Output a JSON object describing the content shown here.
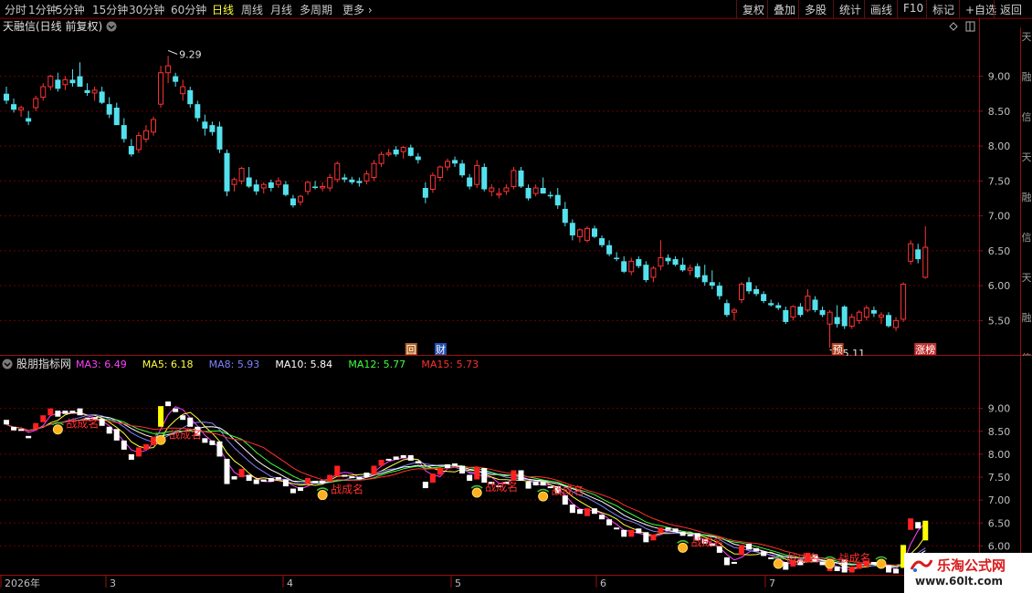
{
  "toolbar": {
    "periods": [
      "分时",
      "1分钟",
      "5分钟",
      "15分钟",
      "30分钟",
      "60分钟",
      "日线",
      "周线",
      "月线",
      "多周期",
      "更多"
    ],
    "active_period": "日线",
    "right_buttons": [
      "复权",
      "叠加",
      "多股",
      "统计",
      "画线",
      "F10",
      "标记",
      "+自选",
      "返回"
    ]
  },
  "main": {
    "title": "天融信(日线 前复权)",
    "side_label": "天融信",
    "high_label": "9.29",
    "low_label": "5.11",
    "badges": [
      "回",
      "财",
      "预",
      "涨榜"
    ]
  },
  "indicator": {
    "name": "股朋指标网",
    "ma": [
      {
        "label": "MA3:",
        "value": "6.49",
        "color": "#ff40ff"
      },
      {
        "label": "MA5:",
        "value": "6.18",
        "color": "#ffff40"
      },
      {
        "label": "MA8:",
        "value": "5.93",
        "color": "#8080ff"
      },
      {
        "label": "MA10:",
        "value": "5.84",
        "color": "#ffffff"
      },
      {
        "label": "MA12:",
        "value": "5.77",
        "color": "#40ff40"
      },
      {
        "label": "MA15:",
        "value": "5.73",
        "color": "#ff3030"
      }
    ],
    "signal_label": "战成名"
  },
  "axis": {
    "date_labels": [
      "2026年",
      "3",
      "4",
      "5",
      "6",
      "7"
    ]
  },
  "watermark": {
    "title": "乐淘公式网",
    "url": "www.60lt.com"
  },
  "colors": {
    "up": "#ff3333",
    "down": "#54e1ee",
    "grid": "#6b0000",
    "axis_text": "#c0c0c0"
  },
  "chart_data": {
    "type": "candlestick",
    "ylim": [
      5.1,
      9.7
    ],
    "yticks": [
      5.5,
      6.0,
      6.5,
      7.0,
      7.5,
      8.0,
      8.5,
      9.0
    ],
    "ohlc": [
      [
        8.75,
        8.85,
        8.6,
        8.65
      ],
      [
        8.6,
        8.68,
        8.48,
        8.52
      ],
      [
        8.52,
        8.58,
        8.42,
        8.55
      ],
      [
        8.4,
        8.5,
        8.3,
        8.35
      ],
      [
        8.55,
        8.72,
        8.5,
        8.68
      ],
      [
        8.7,
        8.9,
        8.65,
        8.85
      ],
      [
        8.85,
        9.02,
        8.8,
        9.0
      ],
      [
        8.95,
        9.05,
        8.78,
        8.82
      ],
      [
        8.88,
        9.0,
        8.8,
        8.95
      ],
      [
        8.95,
        9.1,
        8.85,
        8.9
      ],
      [
        9.0,
        9.2,
        8.95,
        8.85
      ],
      [
        8.8,
        8.9,
        8.72,
        8.76
      ],
      [
        8.76,
        8.85,
        8.65,
        8.8
      ],
      [
        8.78,
        8.85,
        8.6,
        8.62
      ],
      [
        8.6,
        8.7,
        8.4,
        8.45
      ],
      [
        8.55,
        8.62,
        8.4,
        8.3
      ],
      [
        8.3,
        8.4,
        8.05,
        8.1
      ],
      [
        8.0,
        8.1,
        7.85,
        7.88
      ],
      [
        7.95,
        8.2,
        7.9,
        8.15
      ],
      [
        8.1,
        8.3,
        8.05,
        8.22
      ],
      [
        8.2,
        8.42,
        8.15,
        8.38
      ],
      [
        8.6,
        9.15,
        8.55,
        9.05
      ],
      [
        9.05,
        9.29,
        8.9,
        9.15
      ],
      [
        9.0,
        9.05,
        8.85,
        8.92
      ],
      [
        8.75,
        8.95,
        8.65,
        8.85
      ],
      [
        8.8,
        8.85,
        8.55,
        8.6
      ],
      [
        8.6,
        8.65,
        8.35,
        8.4
      ],
      [
        8.35,
        8.45,
        8.15,
        8.25
      ],
      [
        8.3,
        8.35,
        8.15,
        8.2
      ],
      [
        8.28,
        8.35,
        7.9,
        7.95
      ],
      [
        7.9,
        7.95,
        7.28,
        7.35
      ],
      [
        7.45,
        7.55,
        7.35,
        7.52
      ],
      [
        7.5,
        7.7,
        7.45,
        7.68
      ],
      [
        7.55,
        7.7,
        7.4,
        7.42
      ],
      [
        7.45,
        7.52,
        7.3,
        7.35
      ],
      [
        7.4,
        7.48,
        7.32,
        7.45
      ],
      [
        7.48,
        7.52,
        7.35,
        7.4
      ],
      [
        7.45,
        7.55,
        7.4,
        7.5
      ],
      [
        7.45,
        7.5,
        7.28,
        7.3
      ],
      [
        7.25,
        7.3,
        7.12,
        7.15
      ],
      [
        7.2,
        7.3,
        7.15,
        7.28
      ],
      [
        7.35,
        7.5,
        7.3,
        7.48
      ],
      [
        7.42,
        7.5,
        7.38,
        7.4
      ],
      [
        7.4,
        7.48,
        7.35,
        7.42
      ],
      [
        7.4,
        7.6,
        7.35,
        7.55
      ],
      [
        7.52,
        7.78,
        7.48,
        7.75
      ],
      [
        7.55,
        7.6,
        7.48,
        7.52
      ],
      [
        7.52,
        7.56,
        7.45,
        7.48
      ],
      [
        7.5,
        7.55,
        7.42,
        7.47
      ],
      [
        7.5,
        7.65,
        7.45,
        7.6
      ],
      [
        7.55,
        7.8,
        7.5,
        7.75
      ],
      [
        7.75,
        7.92,
        7.7,
        7.88
      ],
      [
        7.88,
        7.96,
        7.85,
        7.9
      ],
      [
        7.95,
        8.0,
        7.85,
        7.88
      ],
      [
        7.92,
        8.0,
        7.82,
        7.98
      ],
      [
        7.98,
        8.02,
        7.85,
        7.86
      ],
      [
        7.85,
        7.9,
        7.75,
        7.8
      ],
      [
        7.4,
        7.48,
        7.18,
        7.26
      ],
      [
        7.38,
        7.62,
        7.33,
        7.58
      ],
      [
        7.55,
        7.72,
        7.5,
        7.7
      ],
      [
        7.7,
        7.82,
        7.65,
        7.78
      ],
      [
        7.8,
        7.85,
        7.7,
        7.75
      ],
      [
        7.75,
        7.8,
        7.55,
        7.58
      ],
      [
        7.55,
        7.6,
        7.38,
        7.42
      ],
      [
        7.45,
        7.8,
        7.4,
        7.72
      ],
      [
        7.7,
        7.75,
        7.35,
        7.38
      ],
      [
        7.35,
        7.45,
        7.28,
        7.4
      ],
      [
        7.3,
        7.4,
        7.25,
        7.32
      ],
      [
        7.35,
        7.45,
        7.3,
        7.4
      ],
      [
        7.42,
        7.7,
        7.38,
        7.65
      ],
      [
        7.65,
        7.7,
        7.4,
        7.42
      ],
      [
        7.4,
        7.45,
        7.22,
        7.25
      ],
      [
        7.32,
        7.45,
        7.28,
        7.4
      ],
      [
        7.4,
        7.55,
        7.32,
        7.32
      ],
      [
        7.3,
        7.35,
        7.25,
        7.28
      ],
      [
        7.3,
        7.4,
        7.1,
        7.15
      ],
      [
        7.1,
        7.2,
        6.85,
        6.9
      ],
      [
        6.9,
        6.95,
        6.65,
        6.72
      ],
      [
        6.7,
        6.82,
        6.62,
        6.8
      ],
      [
        6.65,
        6.85,
        6.62,
        6.82
      ],
      [
        6.82,
        6.86,
        6.68,
        6.7
      ],
      [
        6.68,
        6.72,
        6.55,
        6.58
      ],
      [
        6.58,
        6.65,
        6.42,
        6.45
      ],
      [
        6.4,
        6.48,
        6.35,
        6.38
      ],
      [
        6.35,
        6.42,
        6.18,
        6.2
      ],
      [
        6.2,
        6.4,
        6.15,
        6.35
      ],
      [
        6.38,
        6.42,
        6.25,
        6.28
      ],
      [
        6.3,
        6.35,
        6.05,
        6.08
      ],
      [
        6.12,
        6.28,
        6.05,
        6.25
      ],
      [
        6.28,
        6.65,
        6.22,
        6.4
      ],
      [
        6.4,
        6.45,
        6.3,
        6.35
      ],
      [
        6.38,
        6.42,
        6.28,
        6.3
      ],
      [
        6.3,
        6.4,
        6.2,
        6.22
      ],
      [
        6.22,
        6.3,
        6.15,
        6.25
      ],
      [
        6.28,
        6.32,
        6.1,
        6.12
      ],
      [
        6.15,
        6.3,
        6.0,
        6.05
      ],
      [
        6.05,
        6.22,
        5.95,
        6.0
      ],
      [
        6.0,
        6.05,
        5.8,
        5.85
      ],
      [
        5.75,
        5.8,
        5.55,
        5.58
      ],
      [
        5.62,
        5.68,
        5.5,
        5.65
      ],
      [
        5.8,
        6.05,
        5.75,
        6.02
      ],
      [
        6.05,
        6.12,
        5.88,
        5.92
      ],
      [
        5.95,
        6.0,
        5.85,
        5.88
      ],
      [
        5.88,
        5.92,
        5.75,
        5.78
      ],
      [
        5.75,
        5.8,
        5.7,
        5.72
      ],
      [
        5.72,
        5.76,
        5.65,
        5.68
      ],
      [
        5.65,
        5.7,
        5.45,
        5.48
      ],
      [
        5.55,
        5.72,
        5.5,
        5.7
      ],
      [
        5.7,
        5.75,
        5.55,
        5.58
      ],
      [
        5.65,
        5.95,
        5.62,
        5.85
      ],
      [
        5.8,
        5.85,
        5.62,
        5.65
      ],
      [
        5.65,
        5.7,
        5.55,
        5.58
      ],
      [
        5.45,
        5.65,
        5.11,
        5.62
      ],
      [
        5.55,
        5.72,
        5.4,
        5.45
      ],
      [
        5.7,
        5.72,
        5.38,
        5.42
      ],
      [
        5.42,
        5.6,
        5.38,
        5.55
      ],
      [
        5.5,
        5.65,
        5.45,
        5.62
      ],
      [
        5.55,
        5.72,
        5.5,
        5.68
      ],
      [
        5.65,
        5.7,
        5.55,
        5.6
      ],
      [
        5.55,
        5.62,
        5.45,
        5.58
      ],
      [
        5.58,
        5.62,
        5.4,
        5.42
      ],
      [
        5.4,
        5.55,
        5.35,
        5.5
      ],
      [
        5.52,
        6.05,
        5.48,
        6.02
      ],
      [
        6.35,
        6.65,
        6.3,
        6.6
      ],
      [
        6.52,
        6.6,
        6.32,
        6.38
      ],
      [
        6.12,
        6.85,
        6.1,
        6.55
      ]
    ]
  }
}
